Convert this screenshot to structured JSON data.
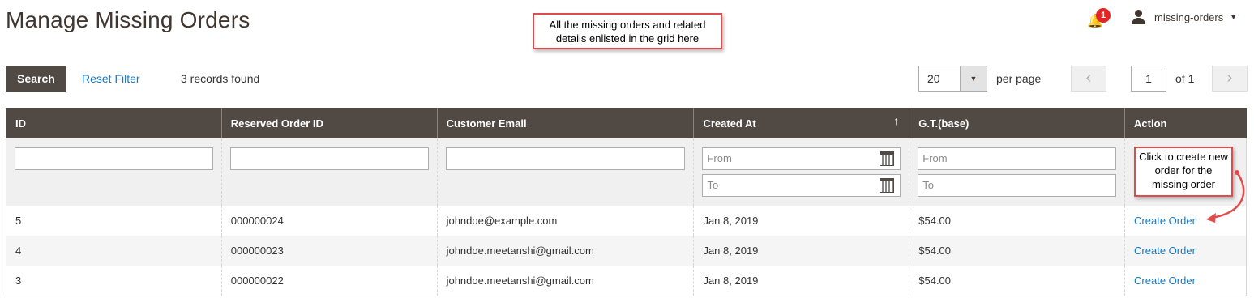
{
  "header": {
    "title": "Manage Missing Orders",
    "notification_count": "1",
    "username": "missing-orders"
  },
  "annotations": {
    "top_note": "All the missing orders and related details enlisted in the grid here",
    "action_note": "Click to create new order for the missing order"
  },
  "toolbar": {
    "search_label": "Search",
    "reset_label": "Reset Filter",
    "records_found": "3 records found",
    "per_page_value": "20",
    "per_page_label": "per page",
    "current_page": "1",
    "of_pages": "of 1"
  },
  "columns": [
    "ID",
    "Reserved Order ID",
    "Customer Email",
    "Created At",
    "G.T.(base)",
    "Action"
  ],
  "filters": {
    "from_placeholder": "From",
    "to_placeholder": "To"
  },
  "rows": [
    {
      "id": "5",
      "reserved_order_id": "000000024",
      "email": "johndoe@example.com",
      "created_at": "Jan 8, 2019",
      "grand_total": "$54.00",
      "action": "Create Order"
    },
    {
      "id": "4",
      "reserved_order_id": "000000023",
      "email": "johndoe.meetanshi@gmail.com",
      "created_at": "Jan 8, 2019",
      "grand_total": "$54.00",
      "action": "Create Order"
    },
    {
      "id": "3",
      "reserved_order_id": "000000022",
      "email": "johndoe.meetanshi@gmail.com",
      "created_at": "Jan 8, 2019",
      "grand_total": "$54.00",
      "action": "Create Order"
    }
  ],
  "colors": {
    "header_bg": "#514943",
    "link": "#1979c3",
    "callout_border": "#e04b4b",
    "badge": "#e22626"
  }
}
